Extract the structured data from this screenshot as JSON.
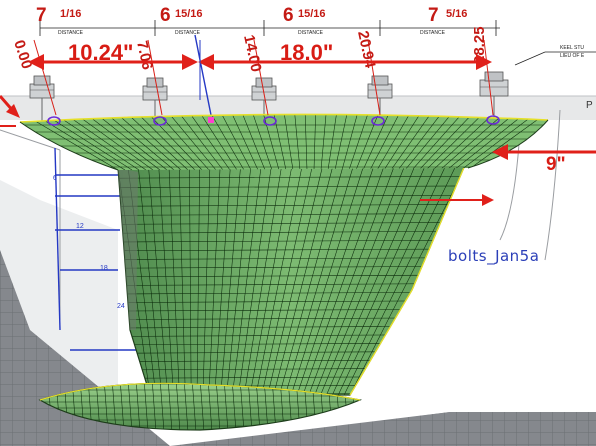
{
  "colors": {
    "hull_green": "#6fa86a",
    "hull_green_light": "#9dd08f",
    "mesh": "#0a2a0a",
    "dimension_red": "#e0201a",
    "annotation_blue": "#2438c4",
    "label_blue": "#2b3fb8",
    "grid_floor": "#7e8187",
    "drawing_paper": "#ffffff"
  },
  "top_dimensions": [
    {
      "whole": "7",
      "fraction": "1/16",
      "label": "DISTANCE"
    },
    {
      "whole": "6",
      "fraction": "15/16",
      "label": "DISTANCE"
    },
    {
      "whole": "6",
      "fraction": "15/16",
      "label": "DISTANCE"
    },
    {
      "whole": "7",
      "fraction": "5/16",
      "label": "DISTANCE"
    }
  ],
  "station_labels": [
    "0.00",
    "7.06",
    "14.00",
    "20.94",
    "28.25"
  ],
  "spans": [
    {
      "text": "10.24\""
    },
    {
      "text": "18.0\""
    }
  ],
  "right_dimension": "9\"",
  "drawing_note": [
    "KEEL STU",
    "LIEU OF E"
  ],
  "depth_ticks": [
    "3",
    "6",
    "12",
    "18",
    "24"
  ],
  "file_label": "bolts_Jan5a"
}
